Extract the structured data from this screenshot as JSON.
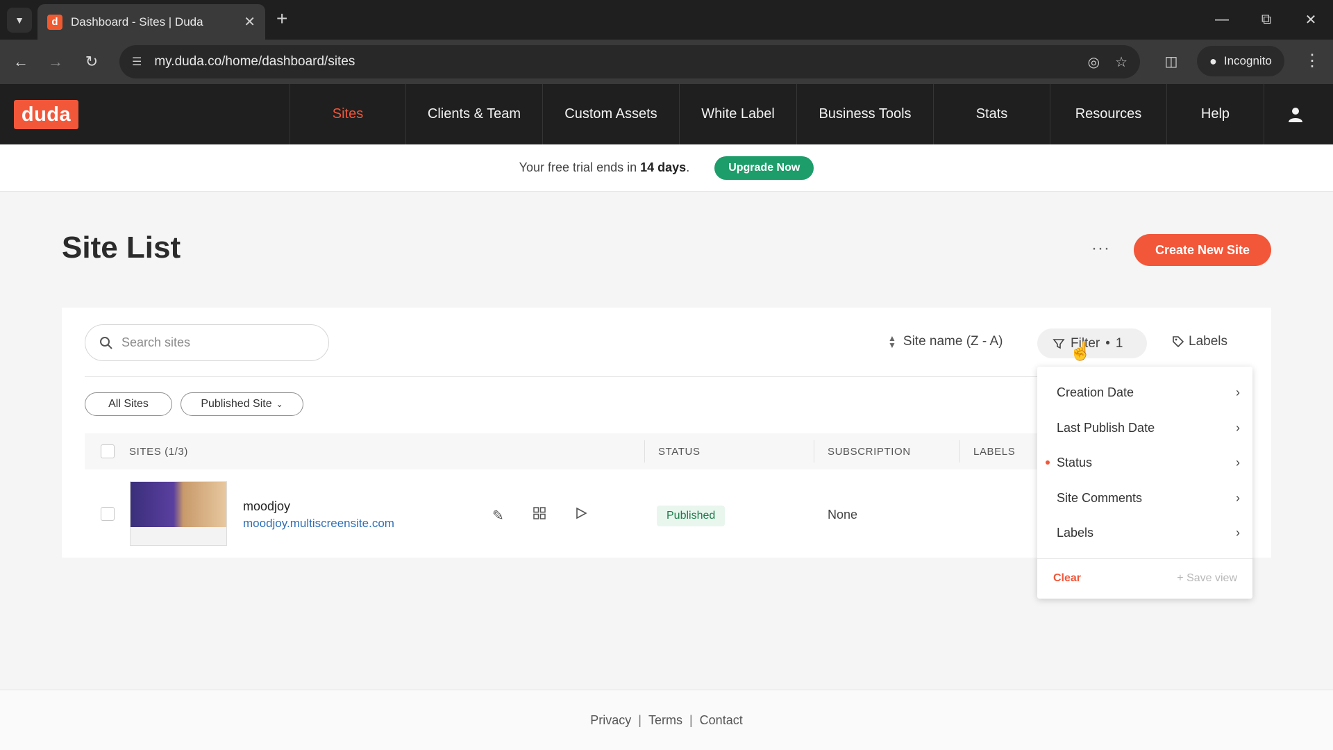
{
  "browser": {
    "tab_title": "Dashboard - Sites | Duda",
    "favicon_letter": "d",
    "url": "my.duda.co/home/dashboard/sites",
    "profile_label": "Incognito"
  },
  "app": {
    "logo_text": "duda",
    "nav": [
      {
        "label": "Sites",
        "active": true
      },
      {
        "label": "Clients & Team"
      },
      {
        "label": "Custom Assets"
      },
      {
        "label": "White Label"
      },
      {
        "label": "Business Tools"
      },
      {
        "label": "Stats"
      },
      {
        "label": "Resources"
      },
      {
        "label": "Help"
      }
    ]
  },
  "banner": {
    "text_prefix": "Your free trial ends in",
    "days": "14 days",
    "text_suffix": ".",
    "upgrade_label": "Upgrade Now"
  },
  "page": {
    "title": "Site List",
    "more_label": "···",
    "create_label": "Create New Site"
  },
  "toolbar": {
    "search_placeholder": "Search sites",
    "sort_label": "Site name (Z - A)",
    "filter_label": "Filter",
    "filter_count": "1",
    "labels_label": "Labels"
  },
  "chips": {
    "all_sites": "All Sites",
    "published": "Published Site"
  },
  "table": {
    "headers": {
      "sites": "SITES (1/3)",
      "status": "STATUS",
      "subscription": "SUBSCRIPTION",
      "labels": "LABELS"
    },
    "rows": [
      {
        "name": "moodjoy",
        "url": "moodjoy.multiscreensite.com",
        "status": "Published",
        "subscription": "None"
      }
    ]
  },
  "filter_menu": {
    "items": [
      {
        "label": "Creation Date",
        "active": false
      },
      {
        "label": "Last Publish Date",
        "active": false
      },
      {
        "label": "Status",
        "active": true
      },
      {
        "label": "Site Comments",
        "active": false
      },
      {
        "label": "Labels",
        "active": false
      }
    ],
    "clear_label": "Clear",
    "save_label": "Save view"
  },
  "footer": {
    "privacy": "Privacy",
    "terms": "Terms",
    "contact": "Contact",
    "separator": "|"
  },
  "colors": {
    "brand": "#f2573a",
    "upgrade": "#1d9d6a",
    "header_bg": "#1f1f1f",
    "link": "#2f6fb5"
  }
}
